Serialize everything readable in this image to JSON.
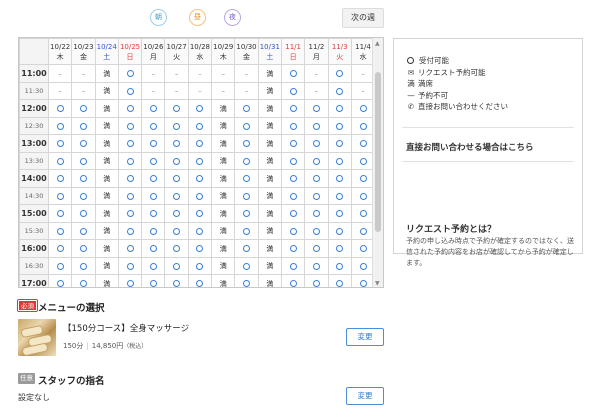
{
  "time_of_day": {
    "morning": "朝",
    "day": "昼",
    "night": "夜"
  },
  "next_week_label": "次の週",
  "calendar": {
    "days": [
      {
        "date": "10/22",
        "dow": "木",
        "type": ""
      },
      {
        "date": "10/23",
        "dow": "金",
        "type": ""
      },
      {
        "date": "10/24",
        "dow": "土",
        "type": "sat"
      },
      {
        "date": "10/25",
        "dow": "日",
        "type": "hol"
      },
      {
        "date": "10/26",
        "dow": "月",
        "type": ""
      },
      {
        "date": "10/27",
        "dow": "火",
        "type": ""
      },
      {
        "date": "10/28",
        "dow": "水",
        "type": ""
      },
      {
        "date": "10/29",
        "dow": "木",
        "type": ""
      },
      {
        "date": "10/30",
        "dow": "金",
        "type": ""
      },
      {
        "date": "10/31",
        "dow": "土",
        "type": "sat"
      },
      {
        "date": "11/1",
        "dow": "日",
        "type": "hol"
      },
      {
        "date": "11/2",
        "dow": "月",
        "type": ""
      },
      {
        "date": "11/3",
        "dow": "火",
        "type": "hol"
      },
      {
        "date": "11/4",
        "dow": "水",
        "type": ""
      }
    ],
    "rows": [
      {
        "time": "11:00",
        "kind": "hour",
        "cells": [
          "-",
          "-",
          "満",
          "o",
          "-",
          "-",
          "-",
          "-",
          "-",
          "満",
          "o",
          "-",
          "o",
          "-"
        ]
      },
      {
        "time": "11:30",
        "kind": "half",
        "cells": [
          "-",
          "-",
          "満",
          "o",
          "-",
          "-",
          "-",
          "-",
          "-",
          "満",
          "o",
          "-",
          "o",
          "-"
        ]
      },
      {
        "time": "12:00",
        "kind": "hour",
        "cells": [
          "o",
          "o",
          "満",
          "o",
          "o",
          "o",
          "o",
          "満",
          "o",
          "満",
          "o",
          "o",
          "o",
          "o"
        ]
      },
      {
        "time": "12:30",
        "kind": "half",
        "cells": [
          "o",
          "o",
          "満",
          "o",
          "o",
          "o",
          "o",
          "満",
          "o",
          "満",
          "o",
          "o",
          "o",
          "o"
        ]
      },
      {
        "time": "13:00",
        "kind": "hour",
        "cells": [
          "o",
          "o",
          "満",
          "o",
          "o",
          "o",
          "o",
          "満",
          "o",
          "満",
          "o",
          "o",
          "o",
          "o"
        ]
      },
      {
        "time": "13:30",
        "kind": "half",
        "cells": [
          "o",
          "o",
          "満",
          "o",
          "o",
          "o",
          "o",
          "満",
          "o",
          "満",
          "o",
          "o",
          "o",
          "o"
        ]
      },
      {
        "time": "14:00",
        "kind": "hour",
        "cells": [
          "o",
          "o",
          "満",
          "o",
          "o",
          "o",
          "o",
          "満",
          "o",
          "満",
          "o",
          "o",
          "o",
          "o"
        ]
      },
      {
        "time": "14:30",
        "kind": "half",
        "cells": [
          "o",
          "o",
          "満",
          "o",
          "o",
          "o",
          "o",
          "満",
          "o",
          "満",
          "o",
          "o",
          "o",
          "o"
        ]
      },
      {
        "time": "15:00",
        "kind": "hour",
        "cells": [
          "o",
          "o",
          "満",
          "o",
          "o",
          "o",
          "o",
          "満",
          "o",
          "満",
          "o",
          "o",
          "o",
          "o"
        ]
      },
      {
        "time": "15:30",
        "kind": "half",
        "cells": [
          "o",
          "o",
          "満",
          "o",
          "o",
          "o",
          "o",
          "満",
          "o",
          "満",
          "o",
          "o",
          "o",
          "o"
        ]
      },
      {
        "time": "16:00",
        "kind": "hour",
        "cells": [
          "o",
          "o",
          "満",
          "o",
          "o",
          "o",
          "o",
          "満",
          "o",
          "満",
          "o",
          "o",
          "o",
          "o"
        ]
      },
      {
        "time": "16:30",
        "kind": "half",
        "cells": [
          "o",
          "o",
          "満",
          "o",
          "o",
          "o",
          "o",
          "満",
          "o",
          "満",
          "o",
          "o",
          "o",
          "o"
        ]
      },
      {
        "time": "17:00",
        "kind": "hour",
        "cells": [
          "o",
          "o",
          "満",
          "o",
          "o",
          "o",
          "o",
          "満",
          "o",
          "満",
          "o",
          "o",
          "o",
          "o"
        ]
      }
    ]
  },
  "legend": {
    "items": [
      {
        "icon": "circle-icon",
        "symbol": "",
        "label": "受付可能"
      },
      {
        "icon": "envelope-icon",
        "symbol": "✉",
        "label": "リクエスト予約可能"
      },
      {
        "icon": "full-icon",
        "symbol": "満",
        "label": "満席"
      },
      {
        "icon": "dash-icon",
        "symbol": "—",
        "label": "予約不可"
      },
      {
        "icon": "phone-icon",
        "symbol": "✆",
        "label": "直接お問い合わせください"
      }
    ],
    "contact_link": "直接お問い合わせる場合はこちら",
    "request_title": "リクエスト予約とは？",
    "request_text": "予約の申し込み時点で予約が確定するのではなく、送信された予約内容をお店が確認してから予約が確定します。"
  },
  "menu_section": {
    "required_badge": "必須",
    "title": "メニューの選択",
    "course_name": "【150分コース】全身マッサージ",
    "duration": "150分",
    "price": "14,850円",
    "tax_note": "（税込）",
    "change_label": "変更"
  },
  "staff_section": {
    "optional_badge": "任意",
    "title": "スタッフの指名",
    "value": "設定なし",
    "change_label": "変更"
  },
  "colors": {
    "available": "#3a7fd6",
    "saturday": "#2f57c8",
    "holiday": "#e33b3b",
    "required": "#d93939",
    "accent": "#2f7ad0"
  }
}
